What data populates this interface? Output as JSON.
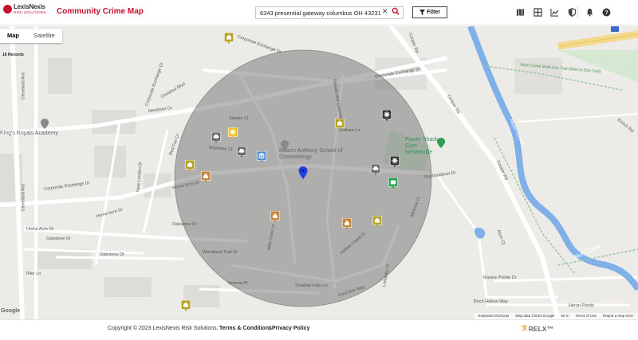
{
  "header": {
    "logo_name": "LexisNexis",
    "logo_sub": "RISK SOLUTIONS",
    "title": "Community Crime Map",
    "search_value": "6343 presential gateway columbus OH 43231",
    "filter_label": "Filter",
    "icons": [
      "map-icon",
      "grid-icon",
      "chart-icon",
      "shield-icon",
      "bell-icon",
      "help-icon"
    ]
  },
  "map": {
    "tabs": [
      {
        "label": "Map",
        "active": true
      },
      {
        "label": "Satellite",
        "active": false
      }
    ],
    "records": "16 Records",
    "google": "Google",
    "footer": {
      "shortcuts": "Keyboard shortcuts",
      "data": "Map data ©2023 Google",
      "scale": "50 m",
      "terms": "Terms of Use",
      "report": "Report a map error"
    },
    "roads": [
      "Corporate Exchange Dr",
      "Corporate Exchange Dr",
      "Corporate Exchange Dr",
      "Corporate Exchange Dr",
      "Cooper Rd",
      "Cooper Rd",
      "Cooper Rd",
      "Cleveland Ave",
      "Cleveland Ave",
      "Home Acre Dr",
      "Home Acre Dr",
      "Home Acre Dr",
      "Oakstone Dr",
      "Oakstone Dr",
      "Oakstone Dr",
      "Tiller Ln",
      "Snyder Ct",
      "Newtown Dr",
      "Brantone Ct",
      "Woodland Trail Dr",
      "Serena Pl",
      "Shadow Falls Ln",
      "Kaut Ave Way",
      "Hollow Creek Ct",
      "Solitare Ln",
      "Presidential Gateway",
      "Diamondbust Dr",
      "Minerva Ct",
      "Alum Creek",
      "Alum Creek",
      "Alum Creek Multi-Use Trail (Ohio to Erie Trail)",
      "Ravine Pointe Dr",
      "Birch Hollow Way",
      "Heron Pointe",
      "Alum Ct",
      "Mills Cove Ln",
      "Lomasky Ct",
      "Enrich Rd",
      "Red Fox Ct",
      "Chestnut Blvd",
      "New London Dr"
    ],
    "pois": [
      {
        "label": "King's Royals Academy",
        "green": false
      },
      {
        "label": "Mason Anthony School of Cosmetology",
        "green": false
      },
      {
        "label": "Power Shack Gym Westerville",
        "green": true
      }
    ],
    "markers": [
      {
        "type": "burglary",
        "color": "#b7a32a"
      },
      {
        "type": "vehicle",
        "color": "#6f6f6f"
      },
      {
        "type": "alert",
        "color": "#f2c01e"
      },
      {
        "type": "vehicle",
        "color": "#6f6f6f"
      },
      {
        "type": "government",
        "color": "#4d8fd1"
      },
      {
        "type": "burglary",
        "color": "#b7a32a"
      },
      {
        "type": "theft",
        "color": "#c5853f"
      },
      {
        "type": "burglary",
        "color": "#b7a32a"
      },
      {
        "type": "alert",
        "color": "#333333"
      },
      {
        "type": "alert",
        "color": "#333333"
      },
      {
        "type": "vehicle",
        "color": "#6f6f6f"
      },
      {
        "type": "drugs",
        "color": "#2aa052"
      },
      {
        "type": "theft",
        "color": "#c5853f"
      },
      {
        "type": "theft",
        "color": "#c5853f"
      },
      {
        "type": "burglary",
        "color": "#b7a32a"
      },
      {
        "type": "burglary",
        "color": "#b7a32a"
      }
    ]
  },
  "footer": {
    "copyright": "Copyright © 2023 LexisNexis Risk Solutions.",
    "terms": "Terms & Conditions",
    "separator": "|",
    "privacy": "Privacy Policy",
    "relx": "RELX™"
  }
}
